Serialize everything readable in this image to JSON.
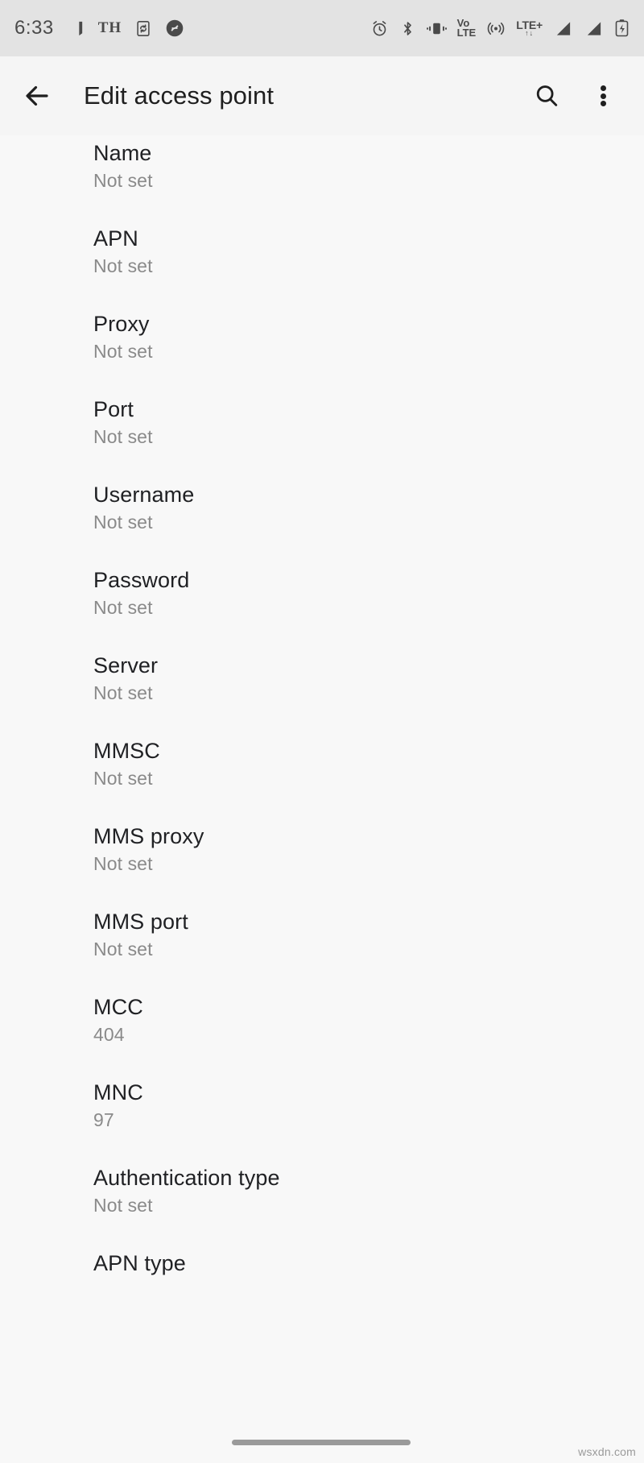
{
  "status_bar": {
    "clock": "6:33",
    "left_icons": [
      {
        "name": "messages-icon",
        "label": "messages"
      },
      {
        "name": "th-keyboard-indicator",
        "label": "TH"
      },
      {
        "name": "phone-sync-icon",
        "label": "phone-sync"
      },
      {
        "name": "shazam-icon",
        "label": "shazam"
      }
    ],
    "right_icons": [
      {
        "name": "alarm-icon",
        "label": "alarm"
      },
      {
        "name": "bluetooth-icon",
        "label": "bluetooth"
      },
      {
        "name": "vibrate-icon",
        "label": "vibrate"
      },
      {
        "name": "volte-icon",
        "label_top": "Vo",
        "label_bottom": "LTE"
      },
      {
        "name": "hotspot-icon",
        "label": "hotspot"
      },
      {
        "name": "lte-plus-icon",
        "label": "LTE+",
        "label_sub": "↑↓"
      },
      {
        "name": "signal-bars-sim1-icon",
        "label": "signal 1"
      },
      {
        "name": "signal-bars-sim2-icon",
        "label": "signal 2"
      },
      {
        "name": "battery-charging-icon",
        "label": "battery charging"
      }
    ]
  },
  "app_bar": {
    "back_label": "Back",
    "title": "Edit access point",
    "search_label": "Search",
    "overflow_label": "More options"
  },
  "settings": {
    "items": [
      {
        "title": "Name",
        "value": "Not set"
      },
      {
        "title": "APN",
        "value": "Not set"
      },
      {
        "title": "Proxy",
        "value": "Not set"
      },
      {
        "title": "Port",
        "value": "Not set"
      },
      {
        "title": "Username",
        "value": "Not set"
      },
      {
        "title": "Password",
        "value": "Not set"
      },
      {
        "title": "Server",
        "value": "Not set"
      },
      {
        "title": "MMSC",
        "value": "Not set"
      },
      {
        "title": "MMS proxy",
        "value": "Not set"
      },
      {
        "title": "MMS port",
        "value": "Not set"
      },
      {
        "title": "MCC",
        "value": "404"
      },
      {
        "title": "MNC",
        "value": "97"
      },
      {
        "title": "Authentication type",
        "value": "Not set"
      },
      {
        "title": "APN type",
        "value": ""
      }
    ]
  },
  "navigation": {
    "gesture_bar_label": "Home gesture bar"
  },
  "watermark": {
    "text": "wsxdn.com"
  },
  "colors": {
    "background": "#f8f8f8",
    "status_bar_bg": "#e3e3e3",
    "app_bar_bg": "#f5f5f5",
    "title_text": "#202124",
    "subtitle_text": "#8a8a8a",
    "icon": "#4a4a4a"
  }
}
